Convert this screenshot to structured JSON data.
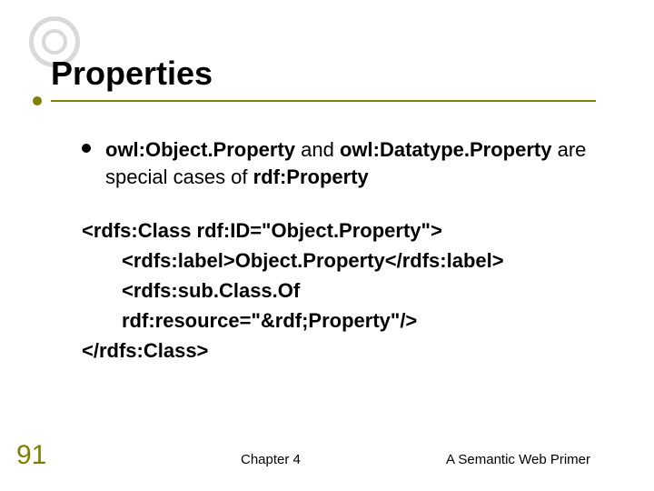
{
  "title": "Properties",
  "bullet": {
    "bold1": "owl:Object.Property",
    "mid1": " and ",
    "bold2": "owl:Datatype.Property",
    "mid2": " are special cases of ",
    "bold3": "rdf:Property"
  },
  "code": {
    "l1": "<rdfs:Class rdf:ID=\"Object.Property\">",
    "l2": "<rdfs:label>Object.Property</rdfs:label>",
    "l3": "<rdfs:sub.Class.Of rdf:resource=\"&rdf;Property\"/>",
    "l4": "</rdfs:Class>"
  },
  "footer": {
    "page": "91",
    "center": "Chapter 4",
    "right": "A Semantic Web Primer"
  }
}
